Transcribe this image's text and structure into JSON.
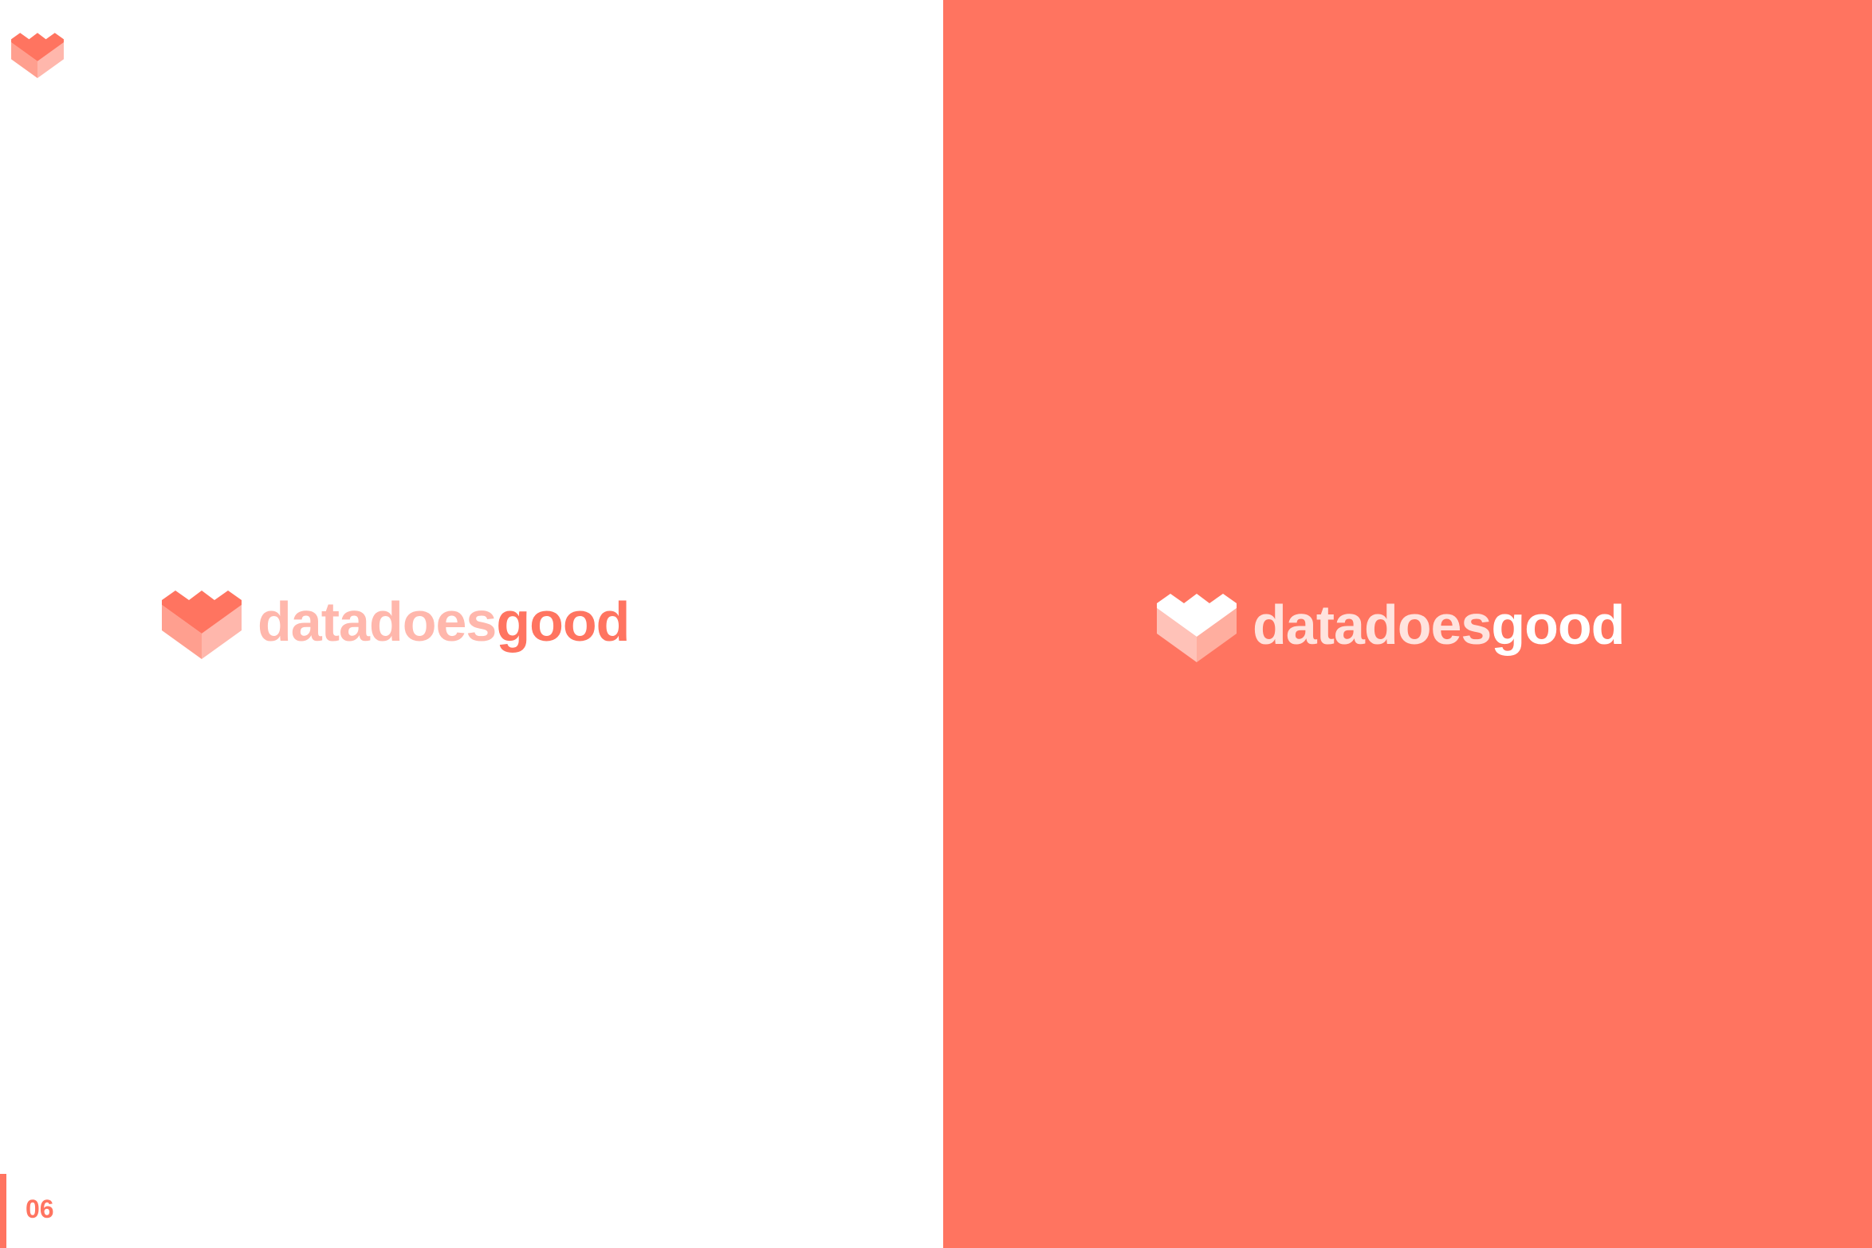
{
  "brand": {
    "word1": "data",
    "word2": "does",
    "word3": "good"
  },
  "page": {
    "number": "06"
  },
  "colors": {
    "coral": "#FF7460",
    "coral_light": "#FFB7AC",
    "coral_mid": "#FF9F8F",
    "white": "#FFFFFF",
    "white_translucent": "#FFE3DE"
  },
  "icons": {
    "logo_mark": "heart-cube-icon"
  }
}
